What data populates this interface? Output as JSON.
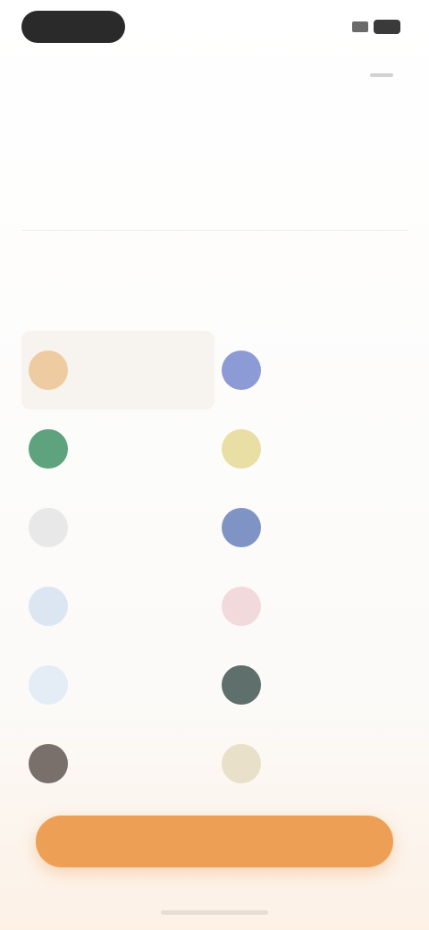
{
  "header": {
    "title": "",
    "menu_icon": "menu-icon"
  },
  "search": {
    "placeholder": ""
  },
  "section": {
    "title": ""
  },
  "topics": [
    {
      "label": "",
      "color": "#eecba0",
      "icon": "topic-icon",
      "selected": true
    },
    {
      "label": "",
      "color": "#8c9ad6",
      "icon": "topic-icon",
      "selected": false
    },
    {
      "label": "",
      "color": "#5ea27e",
      "icon": "topic-icon",
      "selected": false
    },
    {
      "label": "",
      "color": "#e9dfa4",
      "icon": "topic-icon",
      "selected": false
    },
    {
      "label": "",
      "color": "#e8e8e8",
      "icon": "topic-icon",
      "selected": false
    },
    {
      "label": "",
      "color": "#7f93c5",
      "icon": "topic-icon",
      "selected": false
    },
    {
      "label": "",
      "color": "#dce6f2",
      "icon": "topic-icon",
      "selected": false
    },
    {
      "label": "",
      "color": "#f2d9dc",
      "icon": "topic-icon",
      "selected": false
    },
    {
      "label": "",
      "color": "#e4edf6",
      "icon": "topic-icon",
      "selected": false
    },
    {
      "label": "",
      "color": "#5f6f6b",
      "icon": "topic-icon",
      "selected": false
    },
    {
      "label": "",
      "color": "#7a706b",
      "icon": "topic-icon",
      "selected": false
    },
    {
      "label": "",
      "color": "#e8e0c8",
      "icon": "topic-icon",
      "selected": false
    }
  ],
  "cta": {
    "label": "",
    "color": "#eda055"
  }
}
